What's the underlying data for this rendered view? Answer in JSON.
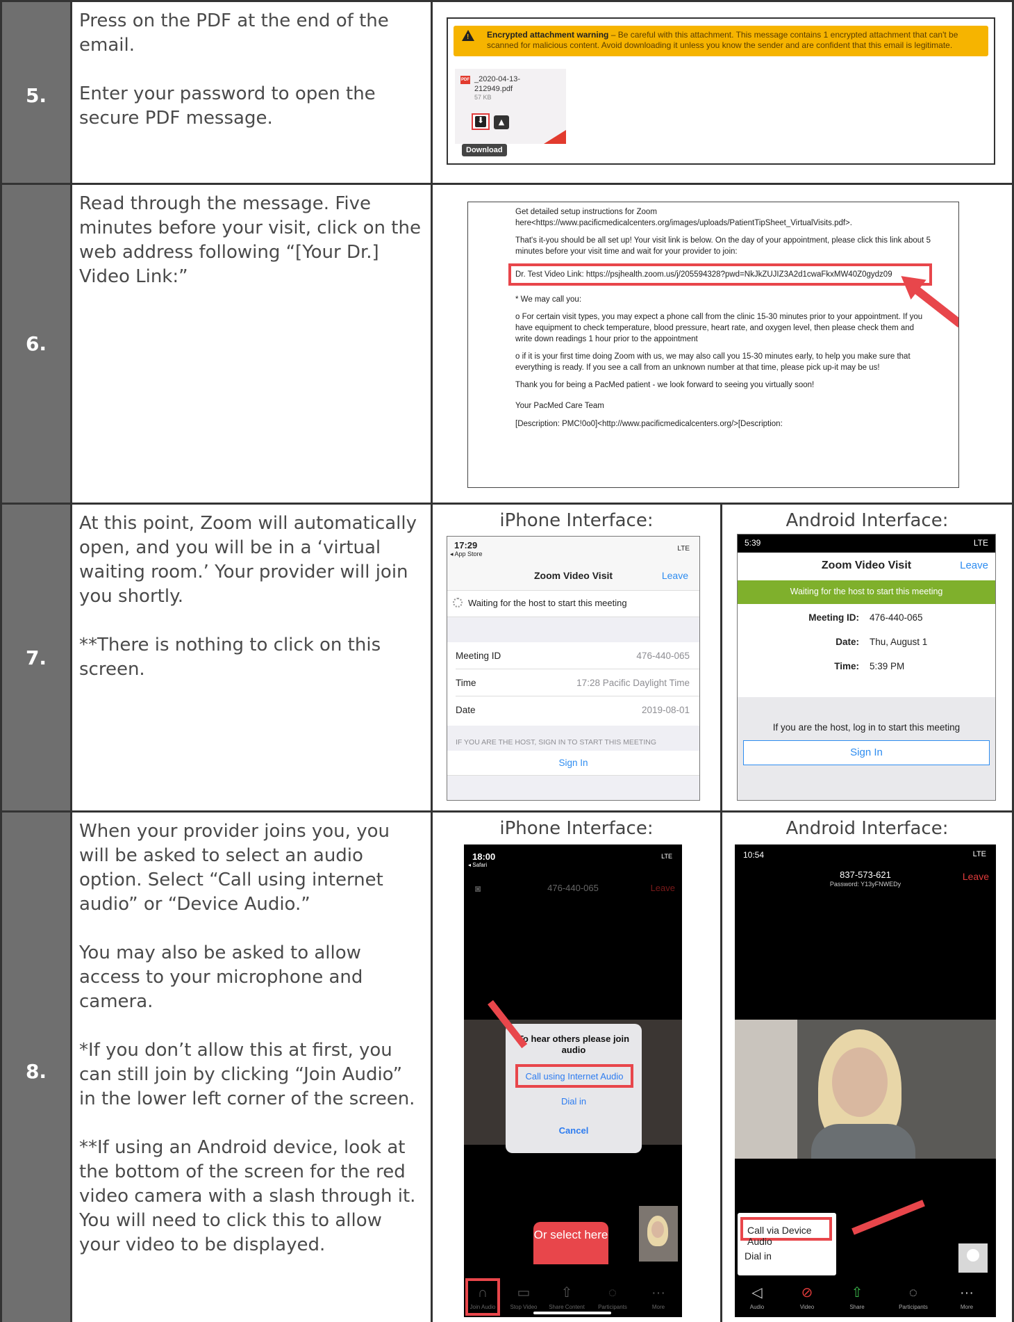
{
  "rows": [
    {
      "number": "5.",
      "paragraphs": [
        "Press on the PDF at the end of the email.",
        "Enter your password to open the secure PDF message."
      ],
      "warning_title": "Encrypted attachment warning",
      "warning_text": " – Be careful with this attachment. This message contains 1 encrypted attachment that can't be scanned for malicious content. Avoid downloading it unless you know the sender and are confident that this email is legitimate.",
      "attachment_name": "_2020-04-13-212949.pdf",
      "attachment_size": "57 KB",
      "pdf_badge": "PDF",
      "tooltip": "Download"
    },
    {
      "number": "6.",
      "paragraphs": [
        "Read through the message. Five minutes before your visit,  click on the web address following  “[Your Dr.] Video Link:”"
      ],
      "doc_lines": [
        "Get detailed setup instructions for Zoom here<https://www.pacificmedicalcenters.org/images/uploads/PatientTipSheet_VirtualVisits.pdf>.",
        "That's it-you should be all set up! Your visit link is below. On the day of your appointment, please click this link about 5 minutes before your visit time and wait for your provider to join:",
        "Dr. Test Video Link: https://psjhealth.zoom.us/j/205594328?pwd=NkJkZUJIZ3A2d1cwaFkxMW40Z0gydz09",
        "*        We may call you:",
        "o   For certain visit types, you may expect a phone call from the clinic 15-30 minutes prior to your appointment. If you have equipment to check temperature, blood pressure, heart rate, and oxygen level, then please check them and write down readings 1 hour prior to the appointment",
        "o   if it is your first time doing Zoom with us, we may also call you 15-30 minutes early, to help you make sure that everything is ready. If you see a call from an unknown number at that time, please pick up-it may be us!",
        "Thank you for being a PacMed patient - we look forward to seeing you virtually soon!",
        "Your PacMed Care Team",
        "[Description: PMC!0o0]<http://www.pacificmedicalcenters.org/>[Description:"
      ]
    },
    {
      "number": "7.",
      "paragraphs": [
        "At this point, Zoom will automatically open, and you will be in a ‘virtual waiting room.’ Your provider will join you shortly.",
        "**There is nothing to click on this screen."
      ],
      "iphone_heading": "iPhone Interface:",
      "android_heading": "Android Interface:",
      "iphone": {
        "time": "17:29",
        "back": "◂ App Store",
        "signal": "LTE",
        "title": "Zoom Video Visit",
        "leave": "Leave",
        "waiting": "Waiting for the host to start this meeting",
        "details": [
          {
            "label": "Meeting ID",
            "value": "476-440-065"
          },
          {
            "label": "Time",
            "value": "17:28 Pacific Daylight Time"
          },
          {
            "label": "Date",
            "value": "2019-08-01"
          }
        ],
        "host_note": "IF YOU ARE THE HOST, SIGN IN TO START THIS MEETING",
        "sign_in": "Sign In"
      },
      "android": {
        "time": "5:39",
        "signal": "LTE",
        "title": "Zoom Video Visit",
        "leave": "Leave",
        "waiting": "Waiting for the host to start this meeting",
        "details": [
          {
            "label": "Meeting ID:",
            "value": "476-440-065"
          },
          {
            "label": "Date:",
            "value": "Thu, August 1"
          },
          {
            "label": "Time:",
            "value": "5:39 PM"
          }
        ],
        "host_note": "If you are the host, log in to start this meeting",
        "sign_in": "Sign In"
      }
    },
    {
      "number": "8.",
      "paragraphs": [
        "When your provider joins you, you will be asked to select an audio option. Select “Call using internet audio” or “Device Audio.”",
        "You may also be asked to allow access to your microphone  and camera.",
        "*If you don’t allow this at first, you can still join by clicking “Join Audio” in the lower left corner of the screen.",
        "**If using an Android device, look at the bottom of the screen for the red video camera with a slash  through it. You will need to click this to allow your video to be displayed."
      ],
      "iphone_heading": "iPhone Interface:",
      "android_heading": "Android Interface:",
      "iphone": {
        "time": "18:00",
        "back": "◂ Safari",
        "signal": "LTE",
        "meeting_id": "476-440-065",
        "leave": "Leave",
        "dialog_title": "To hear others please join audio",
        "option_internet": "Call using Internet Audio",
        "option_dial": "Dial in",
        "option_cancel": "Cancel",
        "bubble": "Or select here",
        "toolbar": [
          "Join Audio",
          "Stop Video",
          "Share Content",
          "Participants",
          "More"
        ]
      },
      "android": {
        "time": "10:54",
        "signal": "LTE",
        "meeting_id": "837-573-621",
        "password": "Password: Y13yFNWEDy",
        "leave": "Leave",
        "option_device": "Call via Device Audio",
        "option_dial": "Dial in",
        "toolbar": [
          "Audio",
          "Video",
          "Share",
          "Participants",
          "More"
        ]
      }
    }
  ]
}
